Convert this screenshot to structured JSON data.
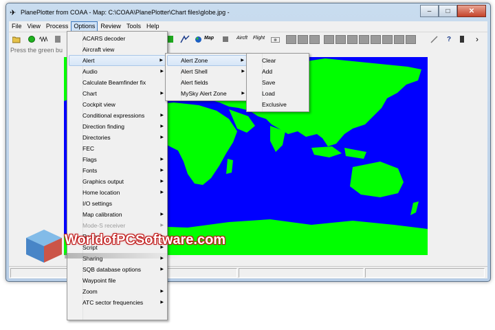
{
  "window": {
    "title": "PlanePlotter from COAA - Map: C:\\COAA\\PlanePlotter\\Chart files\\globe.jpg -",
    "minimize_glyph": "–",
    "maximize_glyph": "□",
    "close_glyph": "✕"
  },
  "menubar": {
    "items": [
      "File",
      "View",
      "Process",
      "Options",
      "Review",
      "Tools",
      "Help"
    ],
    "active_index": 3
  },
  "toolbar": {
    "aircraft_label": "Aircft",
    "flight_label": "Flight",
    "map_label": "Map"
  },
  "workspace": {
    "hint": "Press the green bu"
  },
  "options_menu": {
    "items": [
      {
        "label": "ACARS decoder",
        "submenu": false
      },
      {
        "label": "Aircraft view",
        "submenu": false
      },
      {
        "label": "Alert",
        "submenu": true
      },
      {
        "label": "Audio",
        "submenu": true
      },
      {
        "label": "Calculate Beamfinder fix",
        "submenu": false
      },
      {
        "label": "Chart",
        "submenu": true
      },
      {
        "label": "Cockpit view",
        "submenu": false
      },
      {
        "label": "Conditional expressions",
        "submenu": true
      },
      {
        "label": "Direction finding",
        "submenu": true
      },
      {
        "label": "Directories",
        "submenu": true
      },
      {
        "label": "FEC",
        "submenu": false
      },
      {
        "label": "Flags",
        "submenu": true
      },
      {
        "label": "Fonts",
        "submenu": true
      },
      {
        "label": "Graphics output",
        "submenu": true
      },
      {
        "label": "Home location",
        "submenu": true
      },
      {
        "label": "I/O settings",
        "submenu": false
      },
      {
        "label": "Map calibration",
        "submenu": true
      },
      {
        "label": "Mode-S receiver",
        "submenu": true
      },
      {
        "label": "Range",
        "submenu": true
      },
      {
        "label": "Script",
        "submenu": true
      },
      {
        "label": "Sharing",
        "submenu": true
      },
      {
        "label": "SQB database options",
        "submenu": true
      },
      {
        "label": "Waypoint file",
        "submenu": false
      },
      {
        "label": "Zoom",
        "submenu": true
      },
      {
        "label": "ATC sector frequencies",
        "submenu": true
      }
    ],
    "highlighted": "Alert"
  },
  "alert_submenu": {
    "items": [
      {
        "label": "Alert Zone",
        "submenu": true
      },
      {
        "label": "Alert Shell",
        "submenu": true
      },
      {
        "label": "Alert fields",
        "submenu": false
      },
      {
        "label": "MySky Alert Zone",
        "submenu": true
      }
    ],
    "highlighted": "Alert Zone"
  },
  "alert_zone_submenu": {
    "items": [
      "Clear",
      "Add",
      "Save",
      "Load",
      "Exclusive"
    ]
  },
  "watermark": {
    "text": "WorldofPCSoftware.com"
  },
  "colors": {
    "ocean": "#0000ff",
    "land": "#00ff00",
    "menu_highlight": "#d7e6f7",
    "watermark_outline": "#c01818"
  }
}
